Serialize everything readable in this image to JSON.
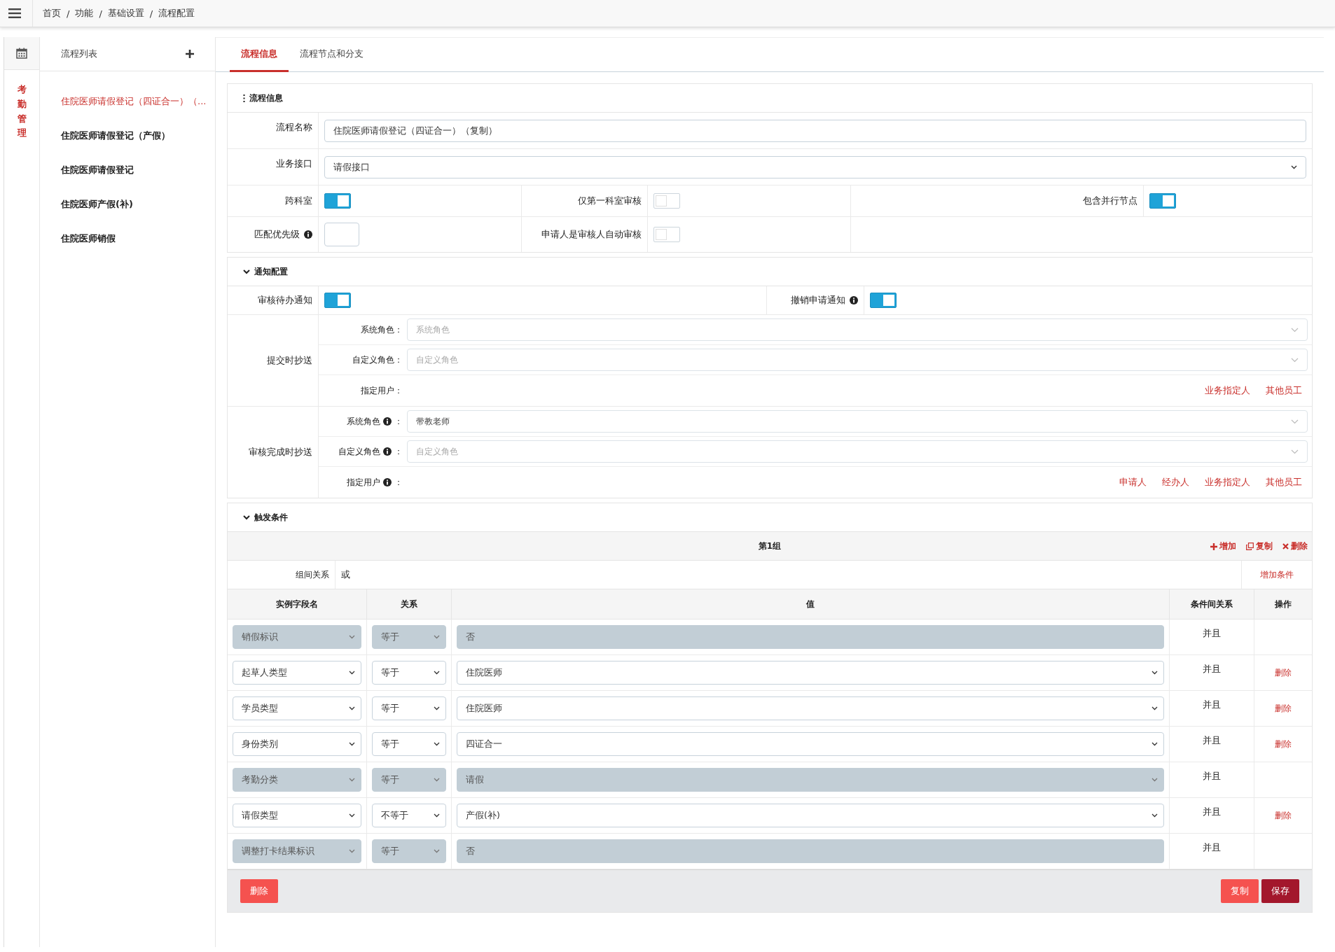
{
  "breadcrumb": {
    "separator": "/",
    "items": [
      "首页",
      "功能",
      "基础设置",
      "流程配置"
    ]
  },
  "side_menu": {
    "label": "考勤管理"
  },
  "flow_list": {
    "title": "流程列表",
    "items": [
      {
        "label": "住院医师请假登记（四证合一）（...",
        "selected": true
      },
      {
        "label": "住院医师请假登记（产假）",
        "selected": false
      },
      {
        "label": "住院医师请假登记",
        "selected": false
      },
      {
        "label": "住院医师产假(补)",
        "selected": false
      },
      {
        "label": "住院医师销假",
        "selected": false
      }
    ]
  },
  "tabs": [
    {
      "label": "流程信息",
      "selected": true
    },
    {
      "label": "流程节点和分支",
      "selected": false
    }
  ],
  "flow_info": {
    "title": "流程信息",
    "name_label": "流程名称",
    "name_value": "住院医师请假登记（四证合一）（复制）",
    "interface_label": "业务接口",
    "interface_value": "请假接口",
    "toggles": [
      {
        "label": "跨科室",
        "on": true
      },
      {
        "label": "仅第一科室审核",
        "on": false
      },
      {
        "label": "包含并行节点",
        "on": true
      }
    ],
    "priority_label": "匹配优先级",
    "auto": {
      "label": "申请人是审核人自动审核",
      "on": false
    }
  },
  "notify": {
    "title": "通知配置",
    "expanded": true,
    "toggles": [
      {
        "label": "审核待办通知",
        "on": true,
        "info": false
      },
      {
        "label": "撤销申请通知",
        "on": true,
        "info": true
      }
    ],
    "cc_groups": [
      {
        "label": "提交时抄送",
        "fields": [
          {
            "label": "系统角色：",
            "info": false,
            "placeholder": "系统角色"
          },
          {
            "label": "自定义角色：",
            "info": false,
            "placeholder": "自定义角色"
          }
        ],
        "user": {
          "label": "指定用户：",
          "info": false
        },
        "links": [
          "业务指定人",
          "其他员工"
        ]
      },
      {
        "label": "审核完成时抄送",
        "fields": [
          {
            "label": "系统角色",
            "info": true,
            "suffix": "：",
            "value": "带教老师"
          },
          {
            "label": "自定义角色",
            "info": true,
            "suffix": "：",
            "placeholder": "自定义角色"
          }
        ],
        "user": {
          "label": "指定用户",
          "info": true,
          "suffix": "："
        },
        "links": [
          "申请人",
          "经办人",
          "业务指定人",
          "其他员工"
        ]
      }
    ]
  },
  "trigger": {
    "title": "触发条件",
    "expanded": true,
    "group": {
      "title": "第1组",
      "actions": [
        {
          "kind": "add",
          "label": "增加"
        },
        {
          "kind": "copy",
          "label": "复制"
        },
        {
          "kind": "delete",
          "label": "删除"
        }
      ],
      "relation_label": "组间关系",
      "relation_value": "或",
      "add_condition": "增加条件",
      "columns": [
        "实例字段名",
        "关系",
        "值",
        "条件间关系",
        "操作"
      ],
      "rows": [
        {
          "field": "销假标识",
          "op": "等于",
          "value": {
            "kind": "text",
            "text": "否"
          },
          "logic": "并且",
          "disabled": true
        },
        {
          "field": "起草人类型",
          "op": "等于",
          "value": {
            "kind": "select",
            "text": "住院医师"
          },
          "logic": "并且",
          "disabled": false,
          "action": "删除"
        },
        {
          "field": "学员类型",
          "op": "等于",
          "value": {
            "kind": "select",
            "text": "住院医师"
          },
          "logic": "并且",
          "disabled": false,
          "action": "删除"
        },
        {
          "field": "身份类别",
          "op": "等于",
          "value": {
            "kind": "select",
            "text": "四证合一"
          },
          "logic": "并且",
          "disabled": false,
          "action": "删除"
        },
        {
          "field": "考勤分类",
          "op": "等于",
          "value": {
            "kind": "select",
            "text": "请假"
          },
          "logic": "并且",
          "disabled": true
        },
        {
          "field": "请假类型",
          "op": "不等于",
          "value": {
            "kind": "select",
            "text": "产假(补)"
          },
          "logic": "并且",
          "disabled": false,
          "action": "删除"
        },
        {
          "field": "调整打卡结果标识",
          "op": "等于",
          "value": {
            "kind": "text",
            "text": "否"
          },
          "logic": "并且",
          "disabled": true
        }
      ]
    }
  },
  "footer": {
    "left": [
      {
        "kind": "delete",
        "label": "删除"
      }
    ],
    "right": [
      {
        "kind": "copy",
        "label": "复制"
      },
      {
        "kind": "save",
        "label": "保存"
      }
    ]
  }
}
